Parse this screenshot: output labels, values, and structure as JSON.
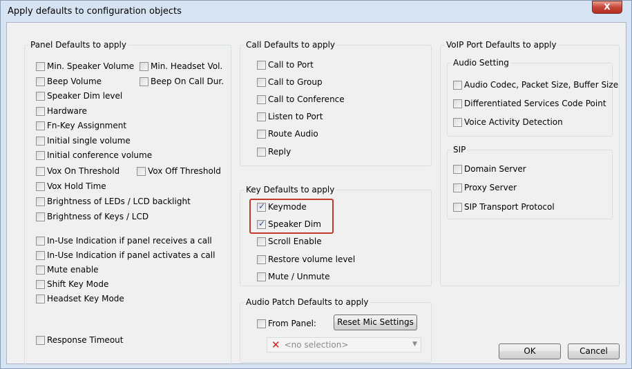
{
  "window": {
    "title": "Apply defaults to configuration objects",
    "close_label": "X"
  },
  "panel_defaults": {
    "title": "Panel Defaults to apply",
    "items": [
      {
        "label": "Min. Speaker Volume",
        "checked": false
      },
      {
        "label": "Min. Headset Vol.",
        "checked": false
      },
      {
        "label": "Beep Volume",
        "checked": false
      },
      {
        "label": "Beep On Call Dur.",
        "checked": false
      },
      {
        "label": "Speaker Dim level",
        "checked": false
      },
      {
        "label": "Hardware",
        "checked": false
      },
      {
        "label": "Fn-Key Assignment",
        "checked": false
      },
      {
        "label": "Initial single volume",
        "checked": false
      },
      {
        "label": "Initial conference volume",
        "checked": false
      },
      {
        "label": "Vox On Threshold",
        "checked": false
      },
      {
        "label": "Vox Off Threshold",
        "checked": false
      },
      {
        "label": "Vox Hold Time",
        "checked": false
      },
      {
        "label": "Brightness of LEDs / LCD backlight",
        "checked": false
      },
      {
        "label": "Brightness of Keys / LCD",
        "checked": false
      },
      {
        "label": "In-Use Indication if panel receives a call",
        "checked": false
      },
      {
        "label": "In-Use Indication if panel activates a call",
        "checked": false
      },
      {
        "label": "Mute enable",
        "checked": false
      },
      {
        "label": "Shift Key Mode",
        "checked": false
      },
      {
        "label": "Headset Key Mode",
        "checked": false
      },
      {
        "label": "Response Timeout",
        "checked": false
      }
    ]
  },
  "call_defaults": {
    "title": "Call Defaults to apply",
    "items": [
      {
        "label": "Call to Port",
        "checked": false
      },
      {
        "label": "Call to Group",
        "checked": false
      },
      {
        "label": "Call to Conference",
        "checked": false
      },
      {
        "label": "Listen to Port",
        "checked": false
      },
      {
        "label": "Route Audio",
        "checked": false
      },
      {
        "label": "Reply",
        "checked": false
      }
    ]
  },
  "key_defaults": {
    "title": "Key Defaults to apply",
    "items": [
      {
        "label": "Keymode",
        "checked": true
      },
      {
        "label": "Speaker Dim",
        "checked": true
      },
      {
        "label": "Scroll Enable",
        "checked": false
      },
      {
        "label": "Restore volume level",
        "checked": false
      },
      {
        "label": "Mute / Unmute",
        "checked": false
      }
    ]
  },
  "audio_patch": {
    "title": "Audio Patch Defaults to apply",
    "from_panel_label": "From Panel:",
    "from_panel_checked": false,
    "reset_button": "Reset Mic Settings",
    "combo_value": "<no selection>",
    "combo_icon": "x-icon",
    "combo_arrow": "▼"
  },
  "voip": {
    "title": "VoIP Port Defaults to apply",
    "audio_setting": {
      "title": "Audio Setting",
      "items": [
        {
          "label": "Audio Codec, Packet Size, Buffer Size",
          "checked": false
        },
        {
          "label": "Differentiated Services Code Point",
          "checked": false
        },
        {
          "label": "Voice Activity Detection",
          "checked": false
        }
      ]
    },
    "sip": {
      "title": "SIP",
      "items": [
        {
          "label": "Domain Server",
          "checked": false
        },
        {
          "label": "Proxy Server",
          "checked": false
        },
        {
          "label": "SIP Transport Protocol",
          "checked": false
        }
      ]
    }
  },
  "buttons": {
    "ok": "OK",
    "cancel": "Cancel"
  },
  "colors": {
    "highlight": "#c0392b",
    "close_button": "#c7463a",
    "window_frame": "#d6e3f2"
  }
}
